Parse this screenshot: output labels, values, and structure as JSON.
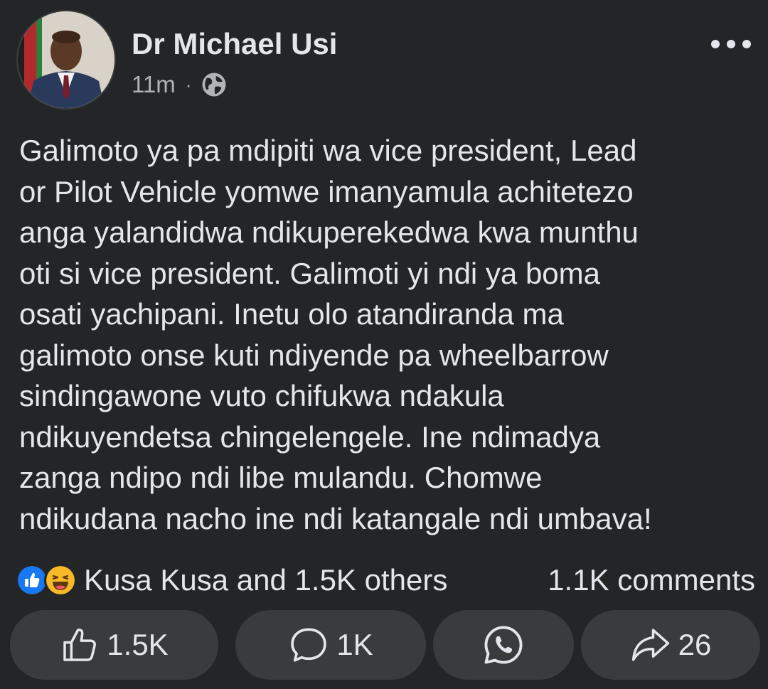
{
  "post": {
    "author": "Dr Michael Usi",
    "timestamp": "11m",
    "separator": "·",
    "audience_icon": "globe-icon",
    "menu_icon": "more-options-icon",
    "text_lines": [
      "Galimoto ya pa mdipiti wa vice president, Lead",
      "or Pilot Vehicle yomwe imanyamula achitetezo",
      "anga yalandidwa ndikuperekedwa kwa munthu",
      "oti si vice president. Galimoti yi ndi ya boma",
      "osati yachipani. Inetu olo atandiranda ma",
      "galimoto onse kuti ndiyende pa wheelbarrow",
      "sindingawone vuto chifukwa ndakula",
      "ndikuyendetsa chingelengele. Ine ndimadya",
      "zanga ndipo ndi libe mulandu. Chomwe",
      "ndikudana nacho ine ndi katangale ndi umbava!"
    ]
  },
  "engagement": {
    "reaction_icons": [
      "like-reaction-icon",
      "haha-reaction-icon"
    ],
    "reactors_text": "Kusa Kusa and 1.5K others",
    "comments_text": "1.1K comments"
  },
  "actions": {
    "like": {
      "icon": "thumbs-up-icon",
      "count": "1.5K"
    },
    "comment": {
      "icon": "comment-bubble-icon",
      "count": "1K"
    },
    "whatsapp": {
      "icon": "whatsapp-icon"
    },
    "share": {
      "icon": "share-arrow-icon",
      "count": "26"
    }
  },
  "colors": {
    "background": "#242526",
    "button_background": "#3a3b3c",
    "primary_text": "#e4e6eb",
    "secondary_text": "#b0b3b8",
    "like_blue": "#1877f2",
    "haha_yellow": "#f7b928"
  }
}
